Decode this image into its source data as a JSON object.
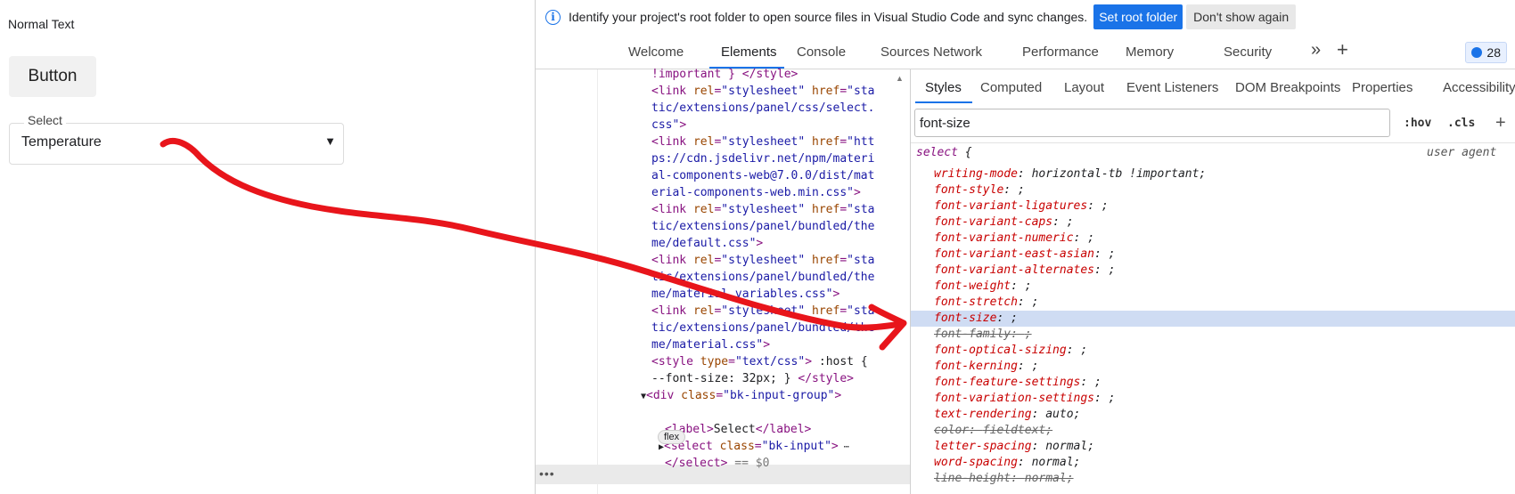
{
  "page": {
    "normal_text": "Normal Text",
    "button_label": "Button",
    "select_label": "Select",
    "select_value": "Temperature",
    "select_arrow": "▼"
  },
  "infobar": {
    "message": "Identify your project's root folder to open source files in Visual Studio Code and sync changes.",
    "set_root_label": "Set root folder",
    "dont_show_label": "Don't show again"
  },
  "tabs": [
    "Welcome",
    "Elements",
    "Console",
    "Sources",
    "Network",
    "Performance",
    "Memory",
    "Security"
  ],
  "more_tabs": "»",
  "add_tab": "+",
  "issues_count": "28",
  "elements": {
    "flex_badge": "flex",
    "dots": "•••"
  },
  "styles_tabs": [
    "Styles",
    "Computed",
    "Layout",
    "Event Listeners",
    "DOM Breakpoints",
    "Properties",
    "Accessibility"
  ],
  "filter_value": "font-size",
  "hov_label": ":hov",
  "cls_label": ".cls",
  "new_rule": "+",
  "rule": {
    "selector": "select",
    "open_brace": " {",
    "origin": "user agent"
  },
  "declarations": [
    {
      "name": "writing-mode",
      "value": "horizontal-tb !important;"
    },
    {
      "name": "font-style",
      "value": ";"
    },
    {
      "name": "font-variant-ligatures",
      "value": ";"
    },
    {
      "name": "font-variant-caps",
      "value": ";"
    },
    {
      "name": "font-variant-numeric",
      "value": ";"
    },
    {
      "name": "font-variant-east-asian",
      "value": ";"
    },
    {
      "name": "font-variant-alternates",
      "value": ";"
    },
    {
      "name": "font-weight",
      "value": ";"
    },
    {
      "name": "font-stretch",
      "value": ";"
    },
    {
      "name": "font-size",
      "value": ";"
    },
    {
      "name": "font-family",
      "value": ";"
    },
    {
      "name": "font-optical-sizing",
      "value": ";"
    },
    {
      "name": "font-kerning",
      "value": ";"
    },
    {
      "name": "font-feature-settings",
      "value": ";"
    },
    {
      "name": "font-variation-settings",
      "value": ";"
    },
    {
      "name": "text-rendering",
      "value": "auto;"
    },
    {
      "name": "color",
      "value": "fieldtext;"
    },
    {
      "name": "letter-spacing",
      "value": "normal;"
    },
    {
      "name": "word-spacing",
      "value": "normal;"
    },
    {
      "name": "line-height",
      "value": "normal;"
    }
  ],
  "highlight_color": "#cfdcf3",
  "accent_color": "#1a73e8",
  "annotation_color": "#e8151b"
}
